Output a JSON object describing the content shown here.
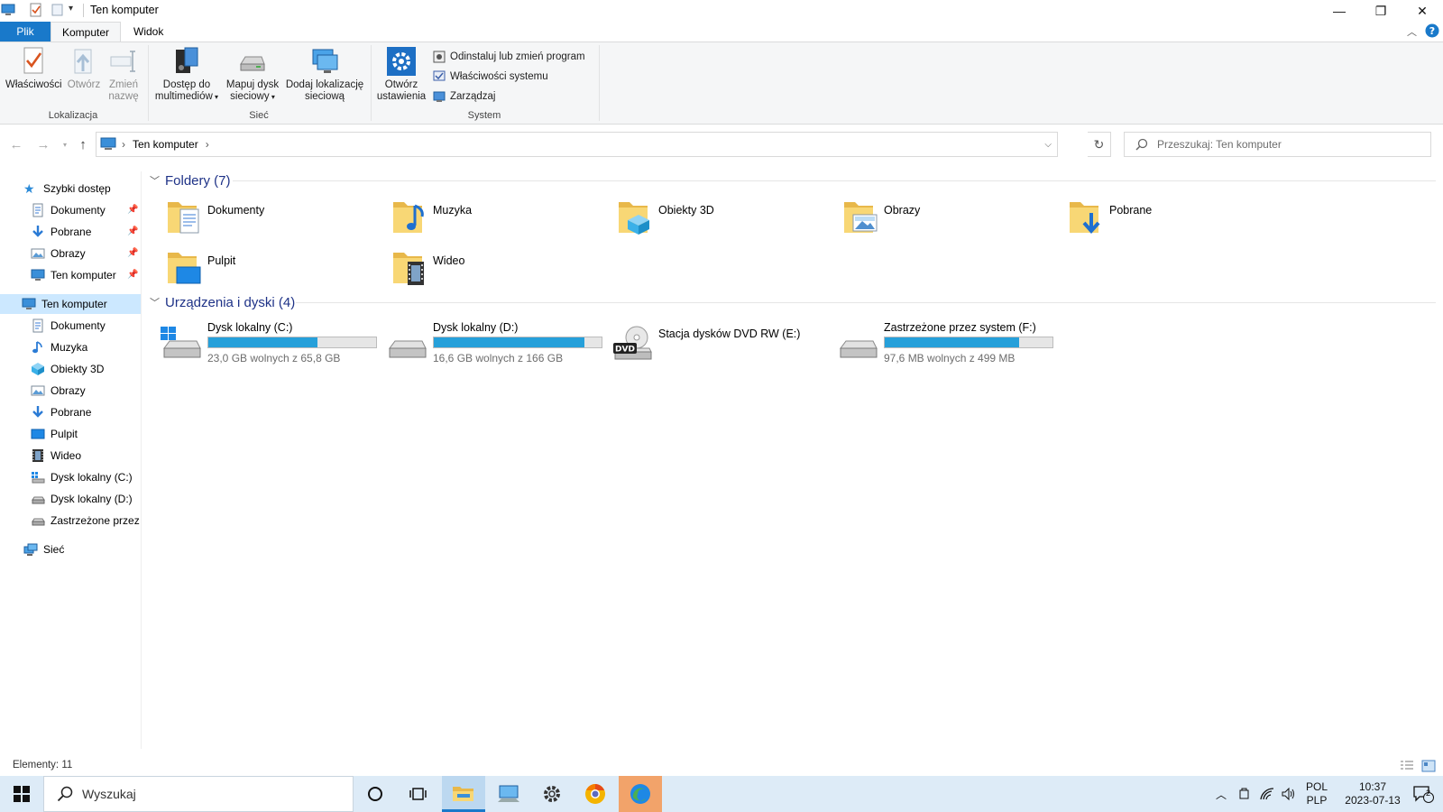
{
  "window": {
    "title": "Ten komputer",
    "minimize": "—",
    "restore": "❐",
    "close": "✕"
  },
  "tabs": {
    "plik": "Plik",
    "komputer": "Komputer",
    "widok": "Widok"
  },
  "ribbon": {
    "lokalizacja": {
      "label": "Lokalizacja",
      "wlasciwosci": "Właściwości",
      "otworz": "Otwórz",
      "zmien_1": "Zmień",
      "zmien_2": "nazwę"
    },
    "siec": {
      "label": "Sieć",
      "dostep_1": "Dostęp do",
      "dostep_2": "multimediów",
      "mapuj_1": "Mapuj dysk",
      "mapuj_2": "sieciowy",
      "dodaj_1": "Dodaj lokalizację",
      "dodaj_2": "sieciową"
    },
    "system": {
      "label": "System",
      "otworz_1": "Otwórz",
      "otworz_2": "ustawienia",
      "odinstaluj": "Odinstaluj lub zmień program",
      "wlasciwosci_systemu": "Właściwości systemu",
      "zarzadzaj": "Zarządzaj"
    }
  },
  "address": {
    "path": "Ten komputer",
    "search_placeholder": "Przeszukaj: Ten komputer"
  },
  "nav": {
    "quick_access": "Szybki dostęp",
    "quick_items": [
      "Dokumenty",
      "Pobrane",
      "Obrazy",
      "Ten komputer"
    ],
    "this_pc": "Ten komputer",
    "pc_items": [
      "Dokumenty",
      "Muzyka",
      "Obiekty 3D",
      "Obrazy",
      "Pobrane",
      "Pulpit",
      "Wideo",
      "Dysk lokalny (C:)",
      "Dysk lokalny (D:)",
      "Zastrzeżone przez sy"
    ],
    "network": "Sieć"
  },
  "main": {
    "folders_header": "Foldery (7)",
    "folders": [
      "Dokumenty",
      "Muzyka",
      "Obiekty 3D",
      "Obrazy",
      "Pobrane",
      "Pulpit",
      "Wideo"
    ],
    "devices_header": "Urządzenia i dyski (4)",
    "drives": [
      {
        "name": "Dysk lokalny (C:)",
        "free": "23,0 GB wolnych z 65,8 GB",
        "used_fraction": 0.65
      },
      {
        "name": "Dysk lokalny (D:)",
        "free": "16,6 GB wolnych z 166 GB",
        "used_fraction": 0.9
      },
      {
        "name": "Stacja dysków DVD RW (E:)",
        "free": "",
        "used_fraction": 0
      },
      {
        "name": "Zastrzeżone przez system (F:)",
        "free": "97,6 MB wolnych z 499 MB",
        "used_fraction": 0.8
      }
    ]
  },
  "status": {
    "elements": "Elementy: 11"
  },
  "taskbar": {
    "search_placeholder": "Wyszukaj",
    "lang_1": "POL",
    "lang_2": "PLP",
    "time": "10:37",
    "date": "2023-07-13",
    "notifications": "2"
  },
  "colors": {
    "accent": "#1979ca",
    "bar_fill": "#26a0da",
    "folder": "#f8d775",
    "header_blue": "#1e3287"
  }
}
